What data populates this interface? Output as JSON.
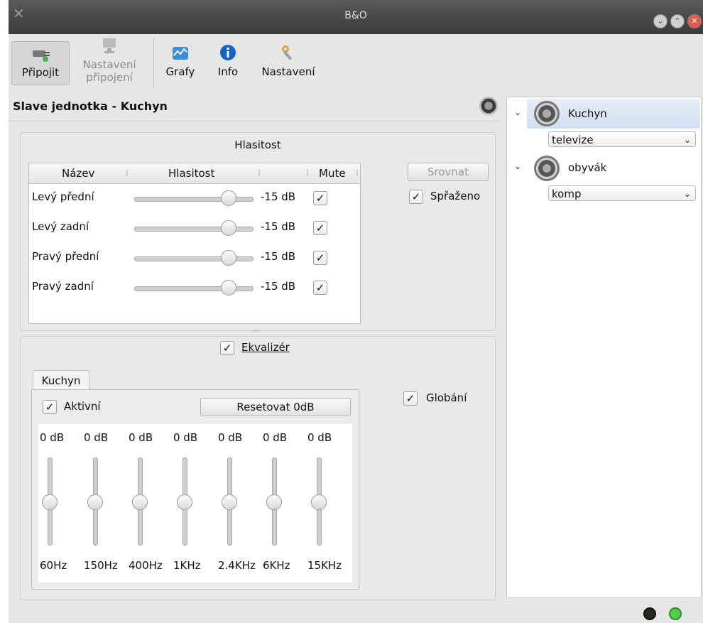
{
  "window": {
    "title": "B&O"
  },
  "toolbar": {
    "connect": "Připojit",
    "connection_settings_line1": "Nastavení",
    "connection_settings_line2": "připojení",
    "graphs": "Grafy",
    "info": "Info",
    "settings": "Nastavení"
  },
  "main": {
    "heading": "Slave jednotka - Kuchyn",
    "volume_group_title": "Hlasitost",
    "columns": {
      "name": "Název",
      "volume": "Hlasitost",
      "mute": "Mute"
    },
    "channels": [
      {
        "name": "Levý přední",
        "value": "-15 dB",
        "level": 0.8,
        "muted": true
      },
      {
        "name": "Levý zadní",
        "value": "-15 dB",
        "level": 0.8,
        "muted": true
      },
      {
        "name": "Pravý přední",
        "value": "-15 dB",
        "level": 0.8,
        "muted": true
      },
      {
        "name": "Pravý zadní",
        "value": "-15 dB",
        "level": 0.8,
        "muted": true
      }
    ],
    "align_button": "Srovnat",
    "linked_label": "Spřaženo",
    "splitter": "...",
    "equalizer_label": "Ekvalizér",
    "tab_label": "Kuchyn",
    "active_label": "Aktivní",
    "reset_button": "Resetovat 0dB",
    "global_label": "Globání",
    "eq_bands": [
      {
        "gain": "0 dB",
        "freq": "60Hz"
      },
      {
        "gain": "0 dB",
        "freq": "150Hz"
      },
      {
        "gain": "0 dB",
        "freq": "400Hz"
      },
      {
        "gain": "0 dB",
        "freq": "1KHz"
      },
      {
        "gain": "0 dB",
        "freq": "2.4KHz"
      },
      {
        "gain": "0 dB",
        "freq": "6KHz"
      },
      {
        "gain": "0 dB",
        "freq": "15KHz"
      }
    ],
    "check_mark": "✓"
  },
  "sidebar": {
    "devices": [
      {
        "name": "Kuchyn",
        "source": "televize",
        "selected": true
      },
      {
        "name": "obyvák",
        "source": "komp",
        "selected": false
      }
    ]
  },
  "status": {
    "led1_color": "#2a2a1a",
    "led2_color": "#55d04a"
  }
}
